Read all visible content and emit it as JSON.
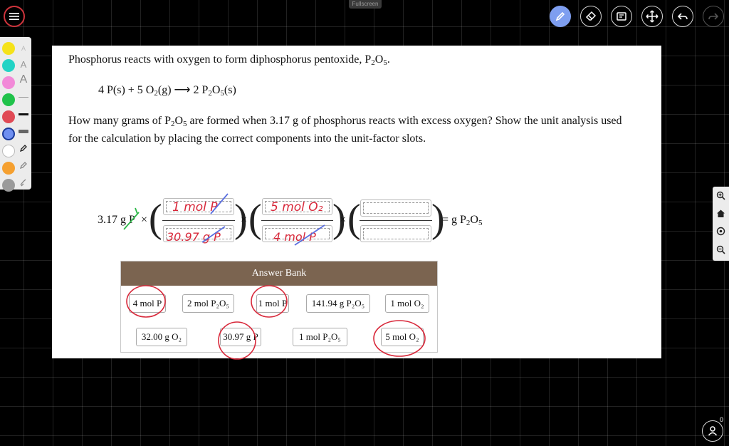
{
  "app": {
    "fullscreen_label": "Fullscreen",
    "toolbar": [
      "pen-icon",
      "eraser-icon",
      "screen-icon",
      "move-icon",
      "undo-icon",
      "redo-icon"
    ],
    "palette_colors": [
      "#f5e21a",
      "#22d3c5",
      "#f28ad8",
      "#20c24a",
      "#e04a55",
      "#6f8ff0",
      "#ffffff",
      "#f5a030",
      "#9a9a9a"
    ],
    "active_color": "#6f8ff0",
    "user_count": "0"
  },
  "question": {
    "intro_text": "Phosphorus reacts with oxygen to form diphosphorus pentoxide, P",
    "intro_sub1": "2",
    "intro_mid": "O",
    "intro_sub2": "5",
    "intro_end": ".",
    "equation": {
      "lhs1": "4 P(s) + 5 O",
      "lhs1_sub": "2",
      "lhs2": "(g) ⟶ 2 P",
      "rhs_sub1": "2",
      "rhs_mid": "O",
      "rhs_sub2": "5",
      "rhs_end": "(s)"
    },
    "line1_a": "How many grams of P",
    "line1_sub1": "2",
    "line1_mid": "O",
    "line1_sub2": "5",
    "line1_b": " are formed when 3.17 g  of phosphorus reacts with excess oxygen? Show the unit analysis used",
    "line2": "for the calculation by placing the correct components into the unit-factor slots."
  },
  "calc": {
    "start": "3.17 g P",
    "times": "×",
    "result_pre": "= g P",
    "result_sub1": "2",
    "result_mid": "O",
    "result_sub2": "5"
  },
  "handwriting": {
    "f1_num": "1 mol P",
    "f1_den": "30.97 g P",
    "f2_num": "5 mol O₂",
    "f2_den": "4 mol P"
  },
  "answer_bank": {
    "title": "Answer Bank",
    "row1": [
      "4 mol P",
      "2 mol P₂O₅",
      "1 mol P",
      "141.94 g P₂O₅",
      "1 mol O₂"
    ],
    "row2": [
      "32.00 g O₂",
      "30.97 g P",
      "1 mol P₂O₅",
      "5 mol O₂"
    ]
  }
}
